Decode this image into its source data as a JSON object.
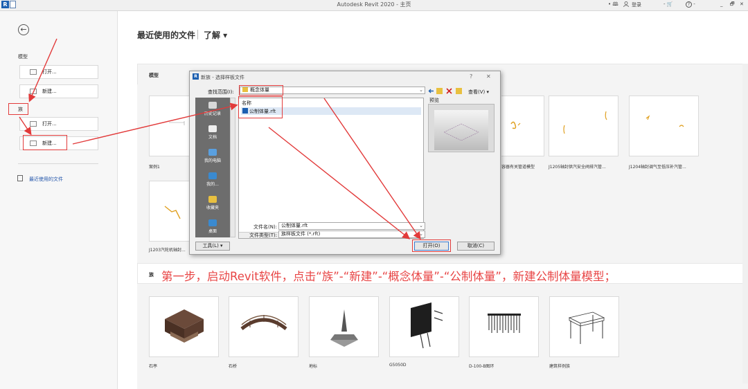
{
  "window": {
    "title": "Autodesk Revit 2020 - 主页",
    "logo": "R",
    "help_icons": "• 🕮 ",
    "login": "登录",
    "cart": "- 🛒",
    "help": "?",
    "help_arrow": "-",
    "minimize": "_",
    "restore": "🗗",
    "close": "✕"
  },
  "left": {
    "back": "←",
    "models_label": "模型",
    "models_open": "打开...",
    "models_new": "新建...",
    "families_label": "族",
    "families_open": "打开...",
    "families_new": "新建...",
    "recent_files": "最近使用的文件"
  },
  "main": {
    "title": "最近使用的文件",
    "learn": "了解 ▾",
    "models_section": "模型",
    "families_section": "族"
  },
  "models": [
    {
      "caption": "案例1"
    },
    {
      "caption": "容器有关管道模型"
    },
    {
      "caption": "J1205轴封供汽安全阀排汽管..."
    },
    {
      "caption": "J1204轴封调气至低压补汽管..."
    },
    {
      "caption": "J1203汽轮机轴封..."
    }
  ],
  "families": [
    {
      "caption": "石亭"
    },
    {
      "caption": "石桥"
    },
    {
      "caption": "地标"
    },
    {
      "caption": "G5050D"
    },
    {
      "caption": "D-100-B图环"
    },
    {
      "caption": "建筑样例族"
    }
  ],
  "dialog": {
    "logo": "R",
    "title": "新族 - 选择样板文件",
    "help": "?",
    "close": "✕",
    "look_in_label": "查找范围(I):",
    "look_in_value": "概念体量",
    "view_label": "查看(V) ▾",
    "column_name": "名称",
    "file_item": "公制体量.rft",
    "preview_label": "预览",
    "places": [
      "历史记录",
      "文档",
      "我的电脑",
      "我的...",
      "收藏夹",
      "桌面"
    ],
    "filename_label": "文件名(N):",
    "filename_value": "公制体量.rft",
    "filetype_label": "文件类型(T):",
    "filetype_value": "族样板文件 (*.rft)",
    "tools": "工具(L)",
    "tools_arrow": "▾",
    "open": "打开(O)",
    "cancel": "取消(C)"
  },
  "annotation": "第一步，启动Revit软件，点击“族”-“新建”-“概念体量”-“公制体量”，新建公制体量模型；",
  "colors": {
    "annotation_red": "#e84545",
    "arrow_red": "#e23a3a",
    "accent_blue": "#1c5fb0"
  }
}
